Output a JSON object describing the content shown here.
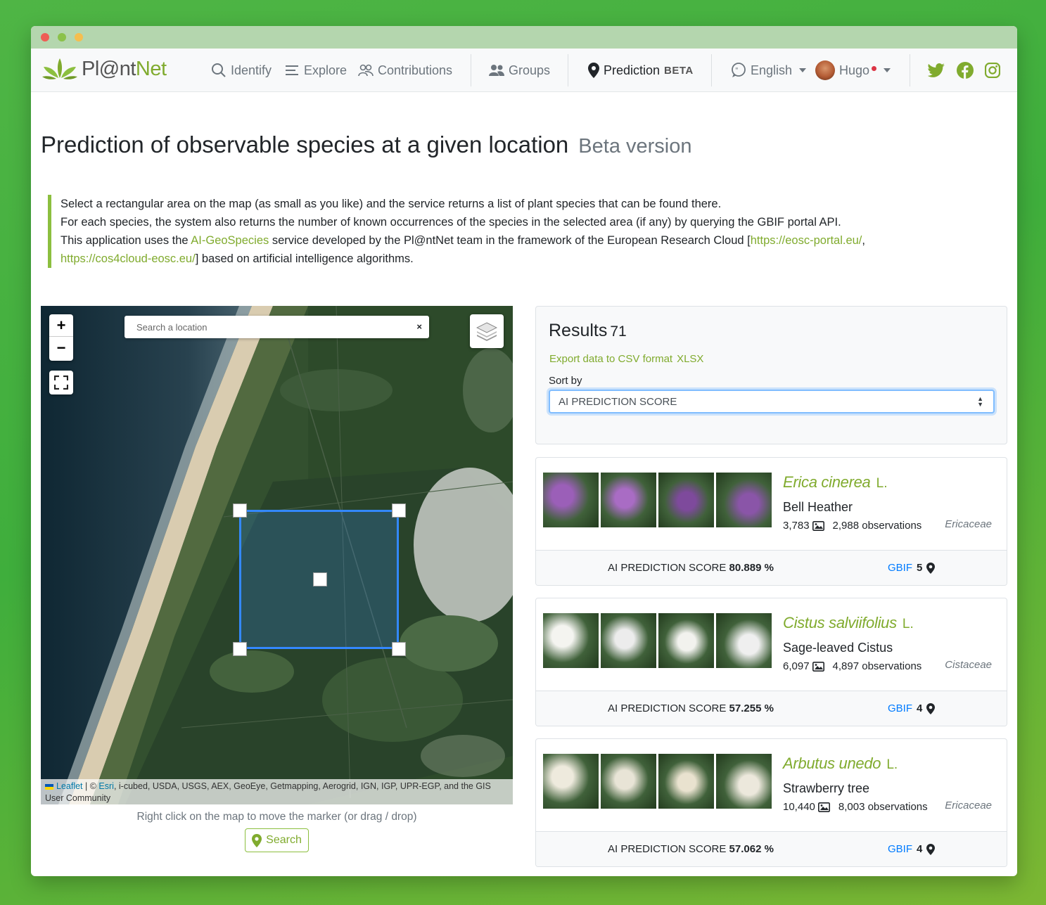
{
  "nav": {
    "logo_text_a": "Pl",
    "logo_text_b": "@nt",
    "logo_text_c": "Net",
    "identify": "Identify",
    "explore": "Explore",
    "contributions": "Contributions",
    "groups": "Groups",
    "prediction": "Prediction",
    "prediction_badge": "BETA",
    "language": "English",
    "user": "Hugo"
  },
  "page": {
    "title": "Prediction of observable species at a given location",
    "subtitle": "Beta version",
    "intro_line1": "Select a rectangular area on the map (as small as you like) and the service returns a list of plant species that can be found there.",
    "intro_line2": "For each species, the system also returns the number of known occurrences of the species in the selected area (if any) by querying the GBIF portal API.",
    "intro_line3_a": "This application uses the ",
    "intro_link_geospecies": "AI-GeoSpecies",
    "intro_line3_b": " service developed by the Pl@ntNet team in the framework of the European Research Cloud [",
    "intro_link_eosc": "https://eosc-portal.eu/",
    "intro_line3_c": ", ",
    "intro_link_cos4cloud": "https://cos4cloud-eosc.eu/",
    "intro_line3_d": "] based on artificial intelligence algorithms."
  },
  "map": {
    "zoom_in": "+",
    "zoom_out": "−",
    "search_placeholder": "Search a location",
    "search_clear": "×",
    "attrib_leaflet": "Leaflet",
    "attrib_sep": " | © ",
    "attrib_esri": "Esri",
    "attrib_rest": ", i-cubed, USDA, USGS, AEX, GeoEye, Getmapping, Aerogrid, IGN, IGP, UPR-EGP, and the GIS User Community",
    "hint": "Right click on the map to move the marker (or drag / drop)",
    "search_button": "Search"
  },
  "results": {
    "title": "Results",
    "count": "71",
    "export_label": "Export data to CSV format",
    "export_xlsx": "XLSX",
    "sort_label": "Sort by",
    "sort_value": "AI PREDICTION SCORE",
    "score_label": "AI PREDICTION SCORE",
    "gbif_label": "GBIF",
    "items": [
      {
        "name": "Erica cinerea",
        "author": "L.",
        "common": "Bell Heather",
        "images": "3,783",
        "observations": "2,988 observations",
        "family": "Ericaceae",
        "score": "80.889 %",
        "gbif": "5",
        "thumb_colors": [
          "#9b5fb8",
          "#a96cc4",
          "#7e4a9c",
          "#8a55a8"
        ]
      },
      {
        "name": "Cistus salviifolius",
        "author": "L.",
        "common": "Sage-leaved Cistus",
        "images": "6,097",
        "observations": "4,897 observations",
        "family": "Cistaceae",
        "score": "57.255 %",
        "gbif": "4",
        "thumb_colors": [
          "#f4f4f0",
          "#ececec",
          "#f2f2ee",
          "#efefef"
        ]
      },
      {
        "name": "Arbutus unedo",
        "author": "L.",
        "common": "Strawberry tree",
        "images": "10,440",
        "observations": "8,003 observations",
        "family": "Ericaceae",
        "score": "57.062 %",
        "gbif": "4",
        "thumb_colors": [
          "#eeeadd",
          "#e8e4d6",
          "#e9e2cf",
          "#ece8dc"
        ]
      }
    ]
  },
  "colors": {
    "brand_green": "#80ab2e",
    "selection_blue": "#3388ff",
    "gbif_blue": "#007bff"
  }
}
